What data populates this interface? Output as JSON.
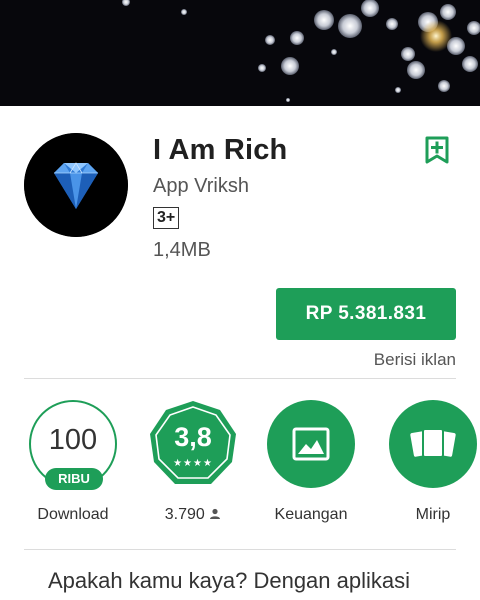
{
  "banner": {
    "description_icon": "diamonds-banner"
  },
  "app": {
    "title": "I Am Rich",
    "developer": "App Vriksh",
    "content_rating": "3+",
    "size": "1,4MB",
    "icon": "diamond-icon"
  },
  "purchase": {
    "price_label": "RP 5.381.831",
    "ads_note": "Berisi iklan"
  },
  "stats": {
    "downloads": {
      "number": "100",
      "unit": "RIBU",
      "label": "Download"
    },
    "rating": {
      "value": "3,8",
      "stars": "★★★★",
      "count_label": "3.790",
      "star_rating": 3.8
    },
    "category": {
      "label": "Keuangan",
      "icon": "image-icon"
    },
    "similar": {
      "label": "Mirip",
      "icon": "cards-icon"
    }
  },
  "description": {
    "text": "Apakah kamu kaya? Dengan aplikasi"
  },
  "colors": {
    "accent": "#1e9e58",
    "banner_bg": "#07070c"
  }
}
